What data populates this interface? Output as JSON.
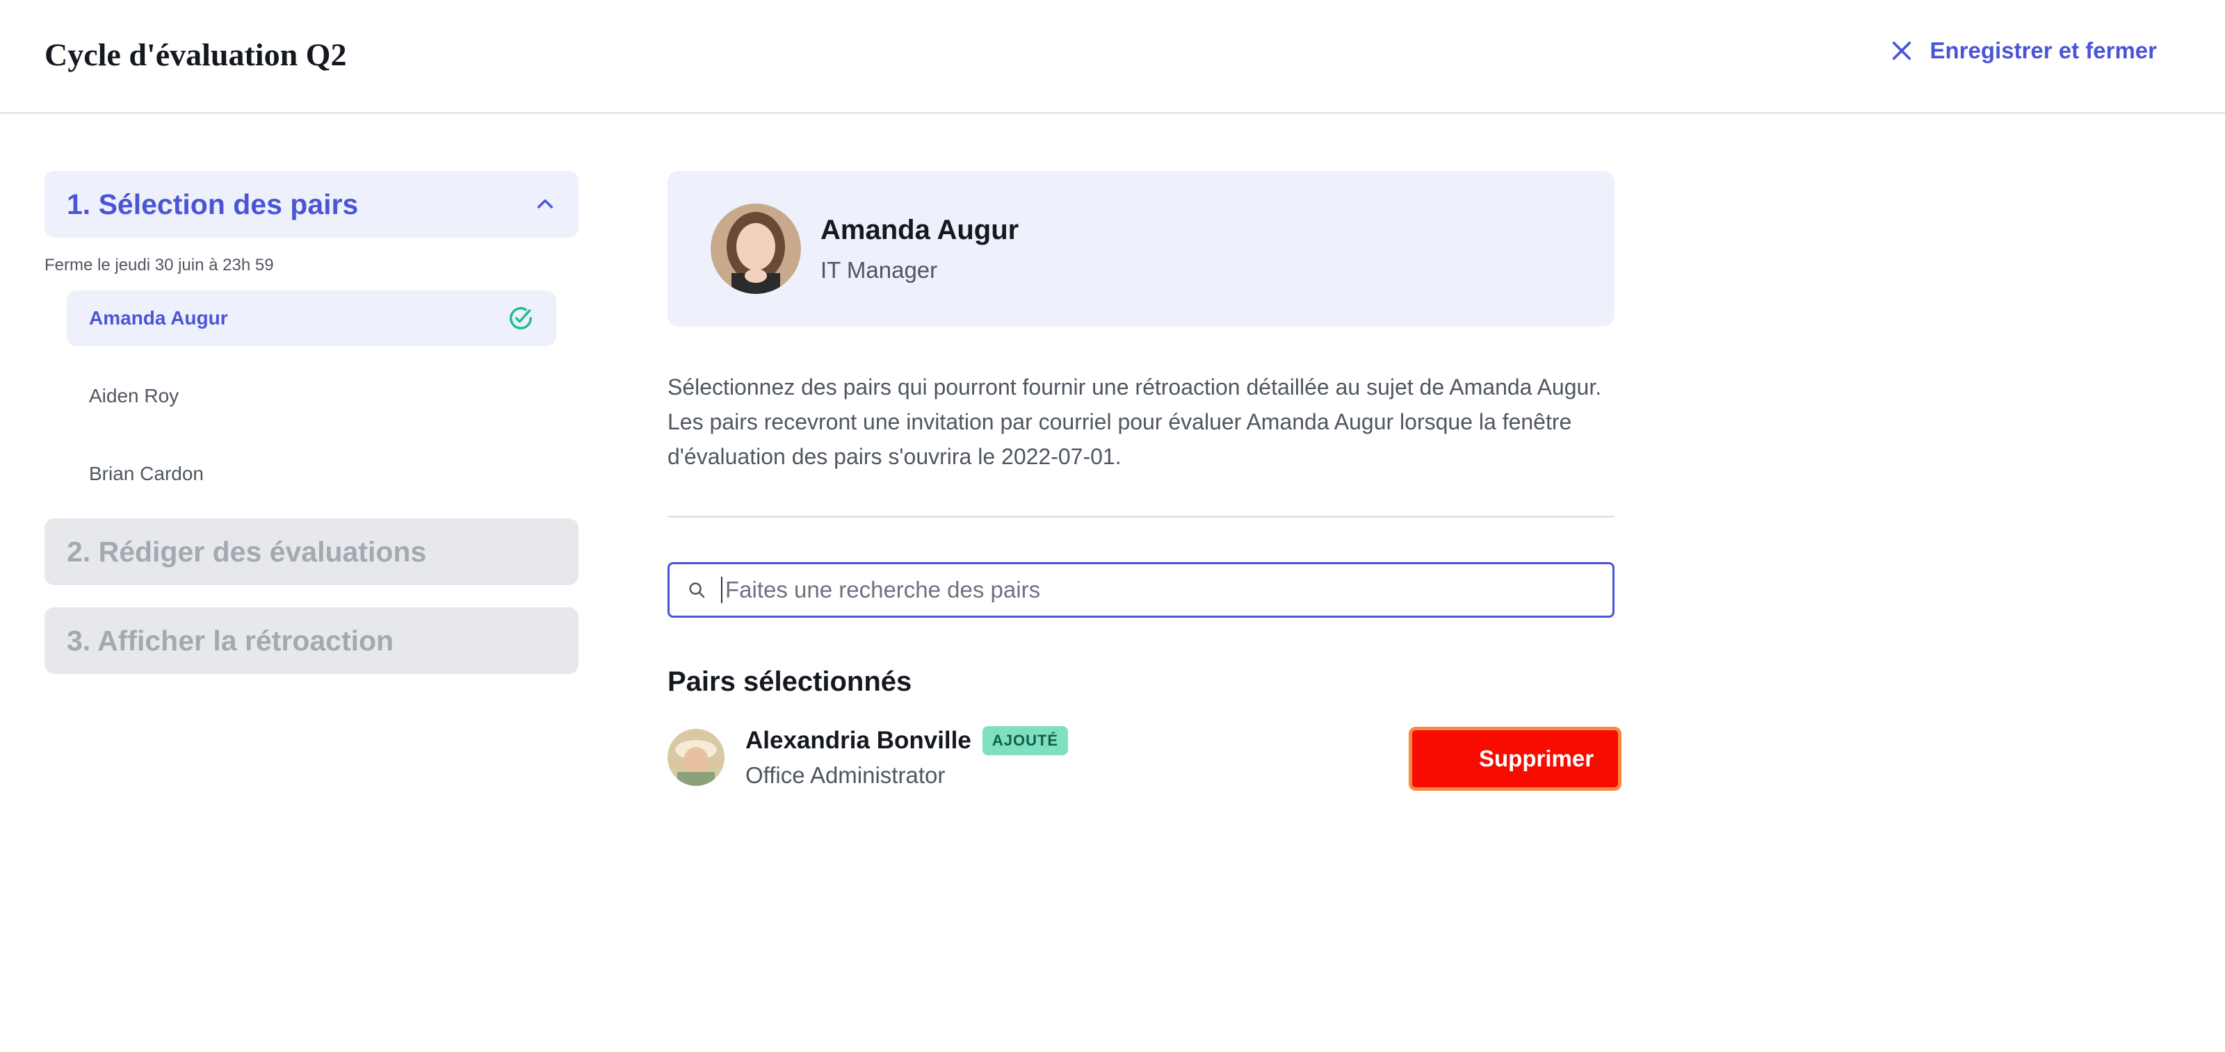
{
  "header": {
    "title": "Cycle d'évaluation Q2",
    "save_close_label": "Enregistrer et fermer"
  },
  "sidebar": {
    "step1": {
      "label": "1. Sélection des pairs",
      "deadline": "Ferme le jeudi 30 juin à 23h 59",
      "people": [
        {
          "name": "Amanda Augur",
          "completed": true
        },
        {
          "name": "Aiden Roy"
        },
        {
          "name": "Brian Cardon"
        }
      ]
    },
    "step2": {
      "label": "2. Rédiger des évaluations"
    },
    "step3": {
      "label": "3. Afficher la rétroaction"
    }
  },
  "profile": {
    "name": "Amanda Augur",
    "role": "IT Manager"
  },
  "description": "Sélectionnez des pairs qui pourront fournir une rétroaction détaillée au sujet de Amanda Augur. Les pairs recevront une invitation par courriel pour évaluer Amanda Augur lorsque la fenêtre d'évaluation des pairs s'ouvrira le 2022-07-01.",
  "search": {
    "placeholder": "Faites une recherche des pairs",
    "value": ""
  },
  "selected_peers": {
    "title": "Pairs sélectionnés",
    "items": [
      {
        "name": "Alexandria Bonville",
        "badge": "AJOUTÉ",
        "role": "Office Administrator",
        "action_label": "Supprimer"
      }
    ]
  },
  "colors": {
    "accent": "#4a55d6",
    "active_bg": "#eef1fb",
    "success": "#1fbf8f",
    "badge_bg": "#7ee0c0",
    "danger": "#f80b00",
    "focus_outline": "#f58a3f"
  },
  "icons": {
    "close": "close-icon",
    "collapse": "chevron-up-icon",
    "completed": "check-circle-icon",
    "search": "search-icon"
  }
}
